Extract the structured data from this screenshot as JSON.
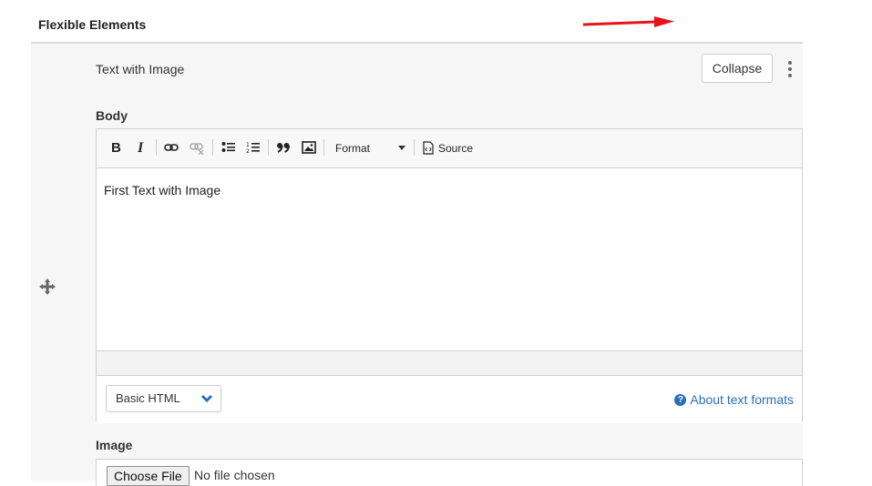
{
  "section": {
    "title": "Flexible Elements"
  },
  "item": {
    "title": "Text with Image",
    "collapse_label": "Collapse"
  },
  "body_field": {
    "label": "Body",
    "toolbar": {
      "bold": "B",
      "italic": "I",
      "format_label": "Format",
      "source_label": "Source"
    },
    "content": "First Text with Image",
    "text_format": {
      "selected": "Basic HTML",
      "about_link": "About text formats"
    }
  },
  "image_field": {
    "label": "Image",
    "choose_label": "Choose File",
    "status": "No file chosen"
  },
  "colors": {
    "link": "#2a6ebb",
    "arrow": "#e8131a"
  }
}
